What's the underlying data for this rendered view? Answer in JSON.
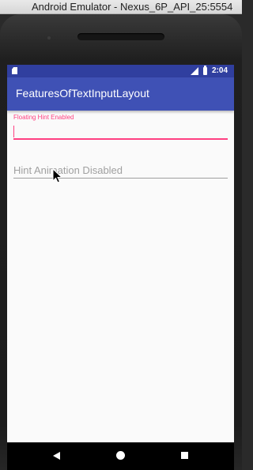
{
  "emulator": {
    "window_title": "Android Emulator - Nexus_6P_API_25:5554"
  },
  "status_bar": {
    "time": "2:04",
    "icons": [
      "sd-card-icon",
      "signal-icon",
      "battery-icon"
    ]
  },
  "app": {
    "title": "FeaturesOfTextInputLayout"
  },
  "field_floating": {
    "floating_label": "Floating Hint Enabled",
    "value": ""
  },
  "field_no_animation": {
    "hint": "Hint Animation Disabled",
    "value": ""
  },
  "nav_bar": {
    "icons": [
      "back-icon",
      "home-icon",
      "recents-icon"
    ]
  },
  "colors": {
    "primary": "#3f51b5",
    "primary_dark": "#303f9f",
    "accent": "#ff4081"
  }
}
